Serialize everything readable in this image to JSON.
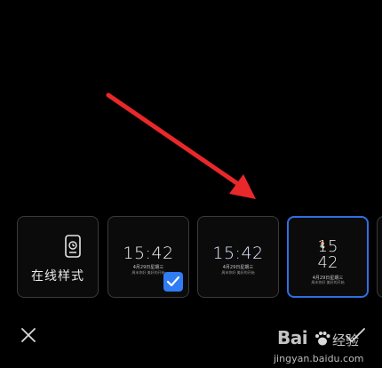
{
  "styles": {
    "online_label": "在线样式",
    "cards": [
      {
        "time": "15:42",
        "date": "4月29日星期三",
        "sub": "周末你好 美好的开始"
      },
      {
        "time": "15:42",
        "date": "4月29日星期三",
        "sub": "周末你好 美好的开始"
      },
      {
        "hour": "15",
        "minute": "42",
        "date": "4月29日星期三",
        "sub": "周末你好 美好的开始"
      }
    ]
  },
  "colors": {
    "selected_border": "#2f6fe0",
    "check_badge": "#2f7cf5",
    "arrow": "#e8282b"
  },
  "icons": {
    "online": "phone-style-icon",
    "check": "checkmark-icon",
    "close": "close-icon",
    "confirm": "checkmark-icon"
  },
  "watermark": {
    "brand": "Bai",
    "suffix": "经验",
    "url": "jingyan.baidu.com"
  }
}
